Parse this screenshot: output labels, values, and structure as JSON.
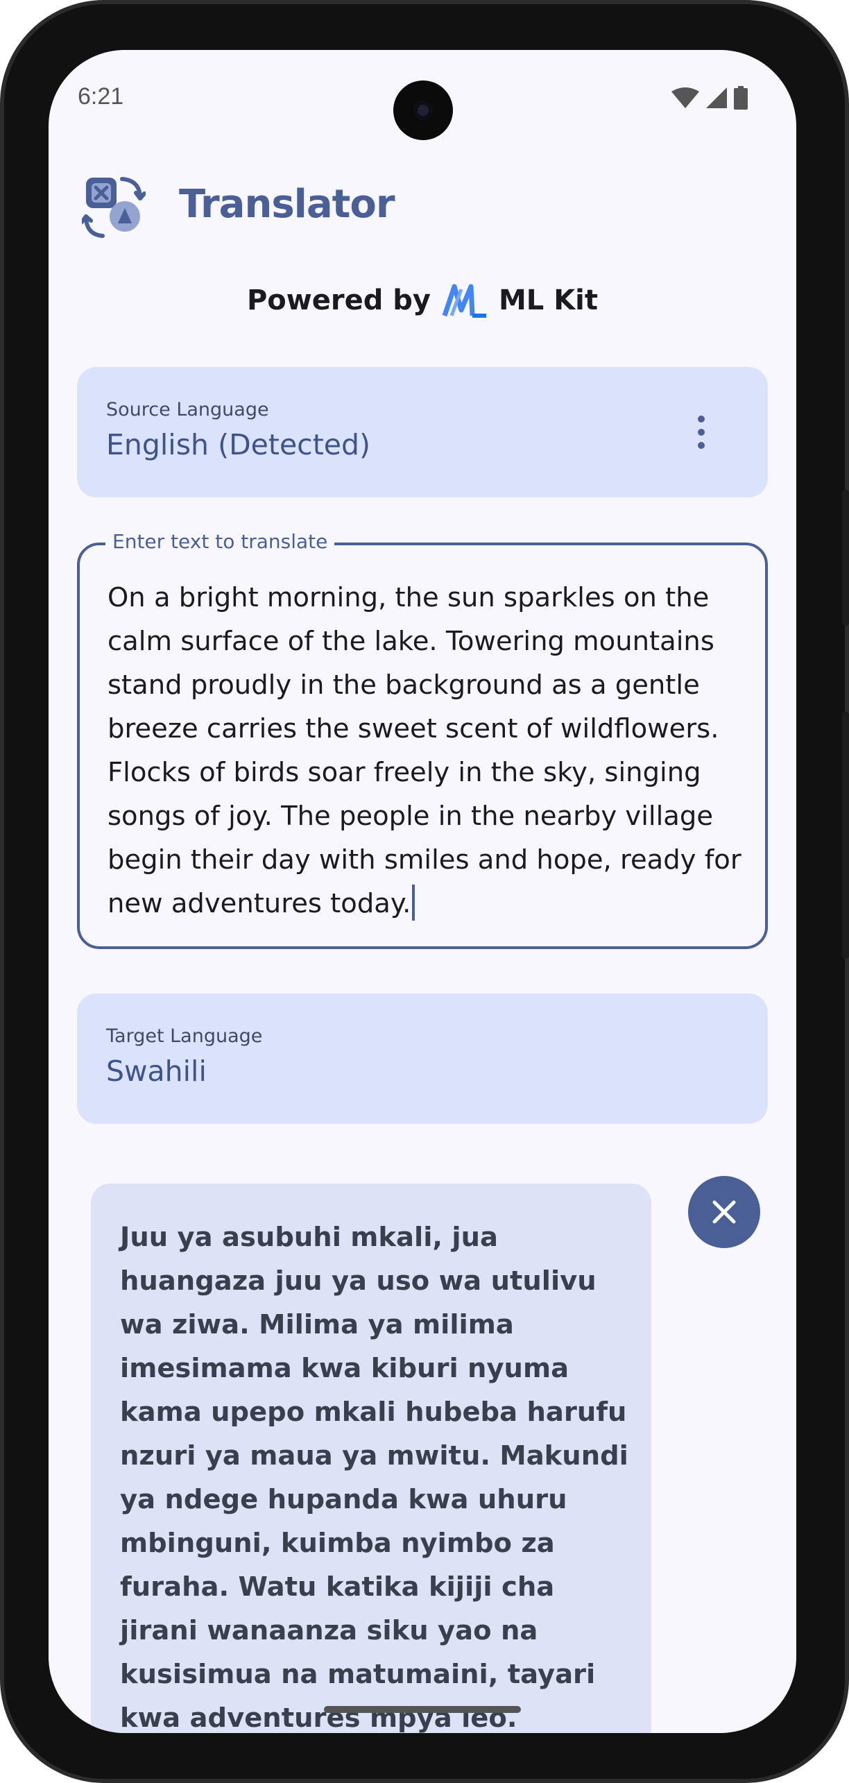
{
  "status_bar": {
    "time": "6:21",
    "icons": [
      "wifi-icon",
      "cell-signal-icon",
      "battery-icon"
    ]
  },
  "header": {
    "app_icon": "translate-app-icon",
    "title": "Translator"
  },
  "powered_by": {
    "prefix": "Powered by",
    "logo": "ml-kit-logo",
    "brand": "ML Kit"
  },
  "source_language": {
    "label": "Source Language",
    "value": "English (Detected)",
    "menu_icon": "more-vert-icon"
  },
  "input": {
    "label": "Enter text to translate",
    "value": "On a bright morning, the sun sparkles on the calm surface of the lake. Towering mountains stand proudly in the background as a gentle breeze carries the sweet scent of wildflowers. Flocks of birds soar freely in the sky, singing songs of joy. The people in the nearby village begin their day with smiles and hope, ready for new adventures today."
  },
  "target_language": {
    "label": "Target Language",
    "value": "Swahili"
  },
  "output": {
    "text": "Juu ya asubuhi mkali, jua huangaza juu ya uso wa utulivu wa ziwa. Milima ya milima imesimama kwa kiburi nyuma kama upepo mkali hubeba harufu nzuri ya maua ya mwitu. Makundi ya ndege hupanda kwa uhuru mbinguni, kuimba nyimbo za furaha. Watu katika kijiji cha jirani wanaanza siku yao na kusisimua na matumaini, tayari kwa adventures mpya leo.",
    "clear_icon": "close-icon"
  },
  "colors": {
    "primary": "#4a5f95",
    "container": "#dbe2fb",
    "output_container": "#dde2f6",
    "background": "#f7f7fd"
  }
}
